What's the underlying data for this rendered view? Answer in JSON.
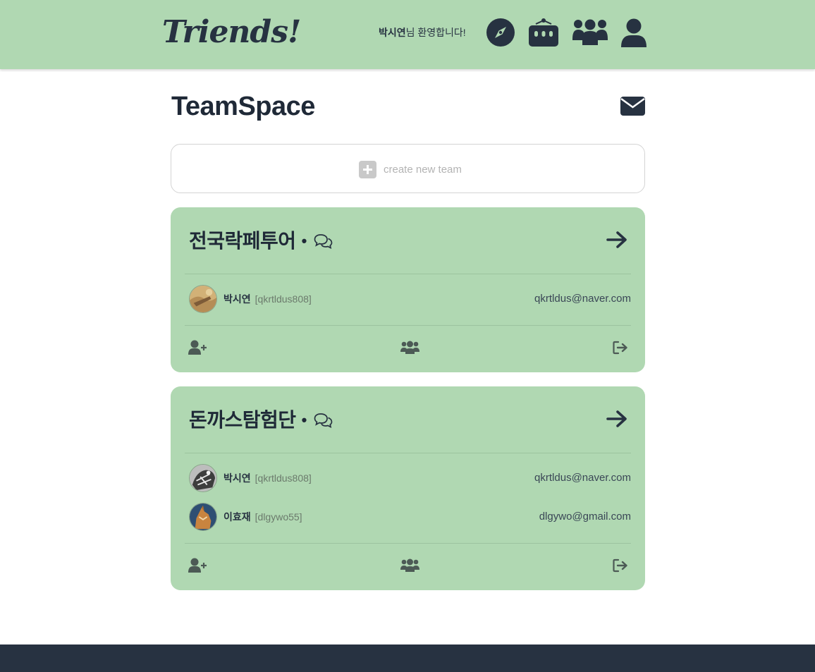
{
  "header": {
    "logo": "Triends!",
    "welcome_name": "박시연",
    "welcome_suffix": "님 환영합니다!",
    "icons": [
      "compass-icon",
      "robot-icon",
      "group-icon",
      "user-icon"
    ]
  },
  "page": {
    "title": "TeamSpace",
    "create_label": "create new team"
  },
  "teams": [
    {
      "name": "전국락페투어",
      "dot": "•",
      "members": [
        {
          "name": "박시연",
          "id": "[qkrtldus808]",
          "email": "qkrtldus@naver.com"
        }
      ]
    },
    {
      "name": "돈까스탐험단",
      "dot": "•",
      "members": [
        {
          "name": "박시연",
          "id": "[qkrtldus808]",
          "email": "qkrtldus@naver.com"
        },
        {
          "name": "이효재",
          "id": "[dlgywo55]",
          "email": "dlgywo@gmail.com"
        }
      ]
    }
  ],
  "colors": {
    "brand_green": "#b0d8b2",
    "dark": "#273241",
    "footer": "#273241"
  }
}
